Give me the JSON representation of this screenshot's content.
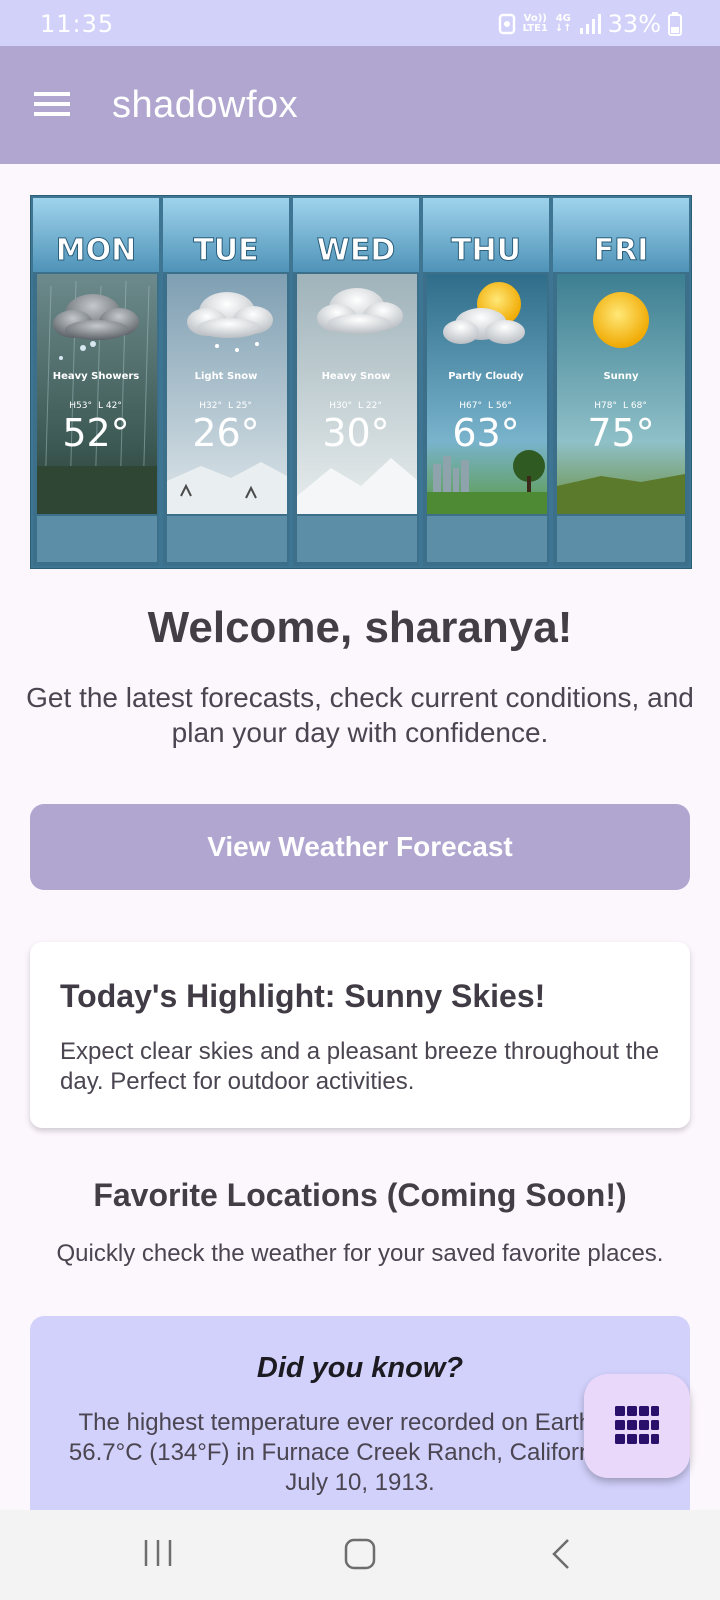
{
  "status_bar": {
    "time": "11:35",
    "network_top": "Vo))",
    "network_bottom": "LTE1",
    "data_top": "4G",
    "battery": "33%"
  },
  "app_bar": {
    "title": "shadowfox",
    "menu_icon": "hamburger-menu-icon"
  },
  "forecast_banner": {
    "days": [
      {
        "day": "MON",
        "condition": "Heavy Showers",
        "high": "H53°",
        "low": "L 42°",
        "temp": "52°",
        "icon": "rain-cloud-icon"
      },
      {
        "day": "TUE",
        "condition": "Light Snow",
        "high": "H32°",
        "low": "L 25°",
        "temp": "26°",
        "icon": "snow-cloud-icon"
      },
      {
        "day": "WED",
        "condition": "Heavy Snow",
        "high": "H30°",
        "low": "L 22°",
        "temp": "30°",
        "icon": "snow-cloud-icon"
      },
      {
        "day": "THU",
        "condition": "Partly Cloudy",
        "high": "H67°",
        "low": "L 56°",
        "temp": "63°",
        "icon": "partly-cloudy-icon"
      },
      {
        "day": "FRI",
        "condition": "Sunny",
        "high": "H78°",
        "low": "L 68°",
        "temp": "75°",
        "icon": "sun-icon"
      }
    ]
  },
  "welcome": {
    "heading": "Welcome, sharanya!",
    "intro": "Get the latest forecasts, check current conditions, and plan your day with confidence."
  },
  "cta": {
    "label": "View Weather Forecast"
  },
  "highlight": {
    "title": "Today's Highlight: Sunny Skies!",
    "body": "Expect clear skies and a pleasant breeze throughout the day. Perfect for outdoor activities."
  },
  "favorites": {
    "title": "Favorite Locations (Coming Soon!)",
    "subtitle": "Quickly check the weather for your saved favorite places."
  },
  "fact": {
    "title": "Did you know?",
    "body": "The highest temperature ever recorded on Earth was 56.7°C (134°F) in Furnace Creek Ranch, California, on July 10, 1913."
  },
  "fab": {
    "icon": "grid-icon"
  },
  "nav": {
    "recents_icon": "recents-icon",
    "home_icon": "home-icon",
    "back_icon": "back-icon"
  },
  "colors": {
    "status_bar": "#d1d1f9",
    "app_bar": "#b0a6cf",
    "background": "#fcf6fd",
    "button": "#b0a6cf",
    "fact_card": "#d2d1fc",
    "fab": "#ead8fb",
    "fab_icon": "#2a0f6b"
  }
}
